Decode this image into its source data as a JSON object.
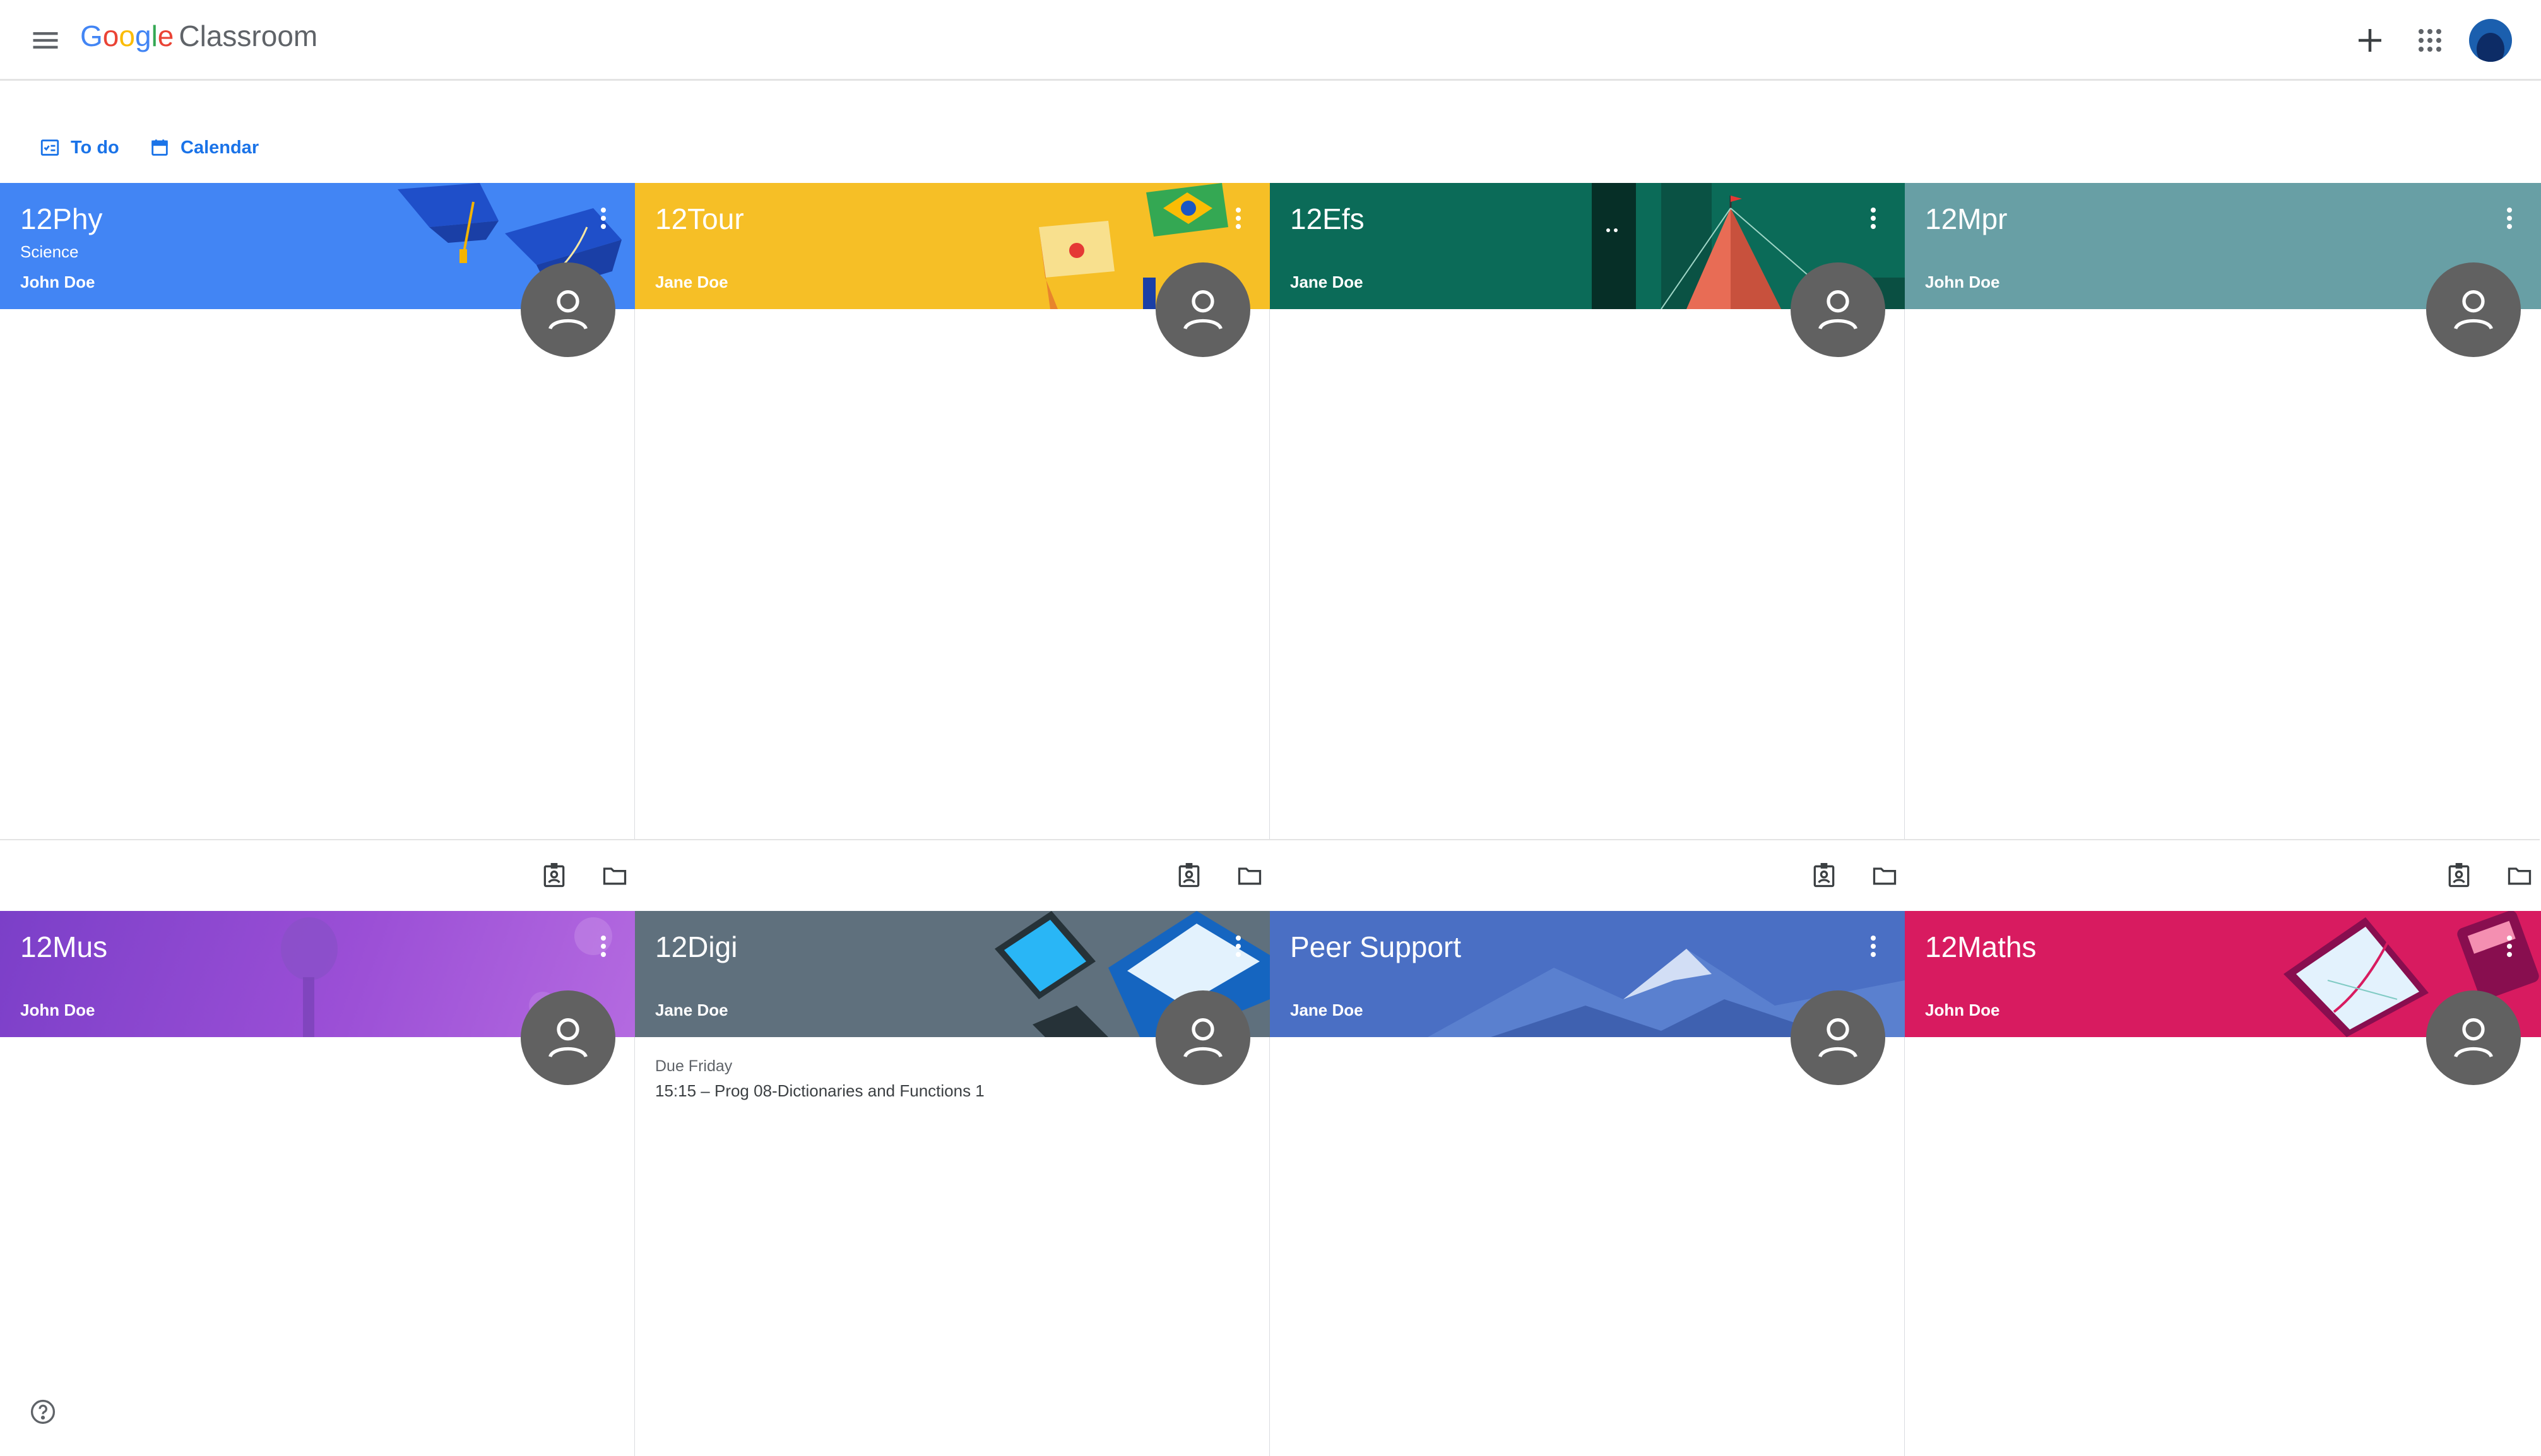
{
  "header": {
    "logo_google": "Google",
    "logo_product": "Classroom"
  },
  "subnav": {
    "todo_label": "To do",
    "calendar_label": "Calendar"
  },
  "colors": {
    "accent": "#1a73e8",
    "card_blue": "#4285f4",
    "card_yellow": "#f6bf26",
    "card_green": "#0b6b58",
    "card_teal": "#689fa5",
    "card_purple": "#8e4fd4",
    "card_slate": "#5f707d",
    "card_mountain": "#4a6fc4",
    "card_pink": "#d81b60"
  },
  "cards": [
    {
      "title": "12Phy",
      "section": "Science",
      "teacher": "John Doe",
      "theme": "graduation-caps"
    },
    {
      "title": "12Tour",
      "section": "",
      "teacher": "Jane Doe",
      "theme": "flags"
    },
    {
      "title": "12Efs",
      "section": "",
      "teacher": "Jane Doe",
      "theme": "camping-tent"
    },
    {
      "title": "12Mpr",
      "section": "",
      "teacher": "John Doe",
      "theme": "plain-teal"
    },
    {
      "title": "12Mus",
      "section": "",
      "teacher": "John Doe",
      "theme": "microphone"
    },
    {
      "title": "12Digi",
      "section": "",
      "teacher": "Jane Doe",
      "theme": "laptops",
      "due_label": "Due Friday",
      "due_item": "15:15 – Prog 08-Dictionaries and Functions 1"
    },
    {
      "title": "Peer Support",
      "section": "",
      "teacher": "Jane Doe",
      "theme": "mountains"
    },
    {
      "title": "12Maths",
      "section": "",
      "teacher": "John Doe",
      "theme": "graph-tablet"
    }
  ],
  "icons": {
    "menu": "hamburger-menu-icon",
    "create": "plus-icon",
    "apps": "google-apps-icon",
    "account": "account-avatar",
    "todo": "assignment-icon",
    "calendar": "calendar-icon",
    "more": "more-vert-icon",
    "teacher_avatar": "person-icon",
    "work": "assignment-ind-icon",
    "folder": "folder-icon",
    "help": "help-icon"
  }
}
